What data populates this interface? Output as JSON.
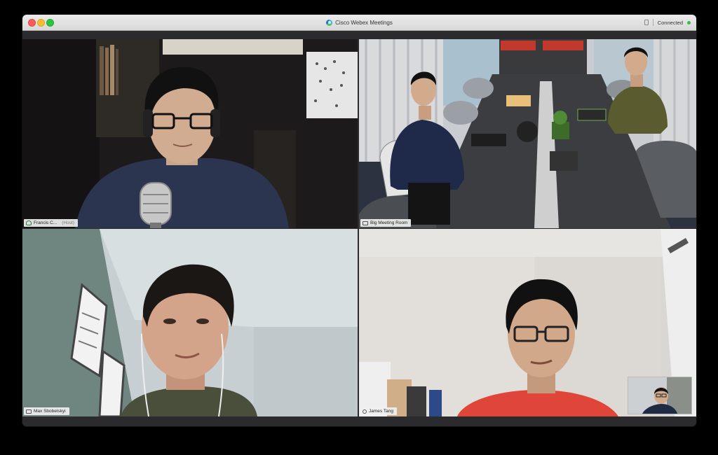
{
  "window": {
    "title": "Cisco Webex Meetings",
    "status": "Connected",
    "logo_icon": "webex-logo-icon"
  },
  "participants": [
    {
      "name": "Francis C...",
      "role": "(Host)",
      "icon": "people-icon"
    },
    {
      "name": "Big Meeting Room",
      "icon": "room-device-icon"
    },
    {
      "name": "Max Sbobelskyi",
      "icon": "device-icon"
    },
    {
      "name": "James Tang",
      "icon": "phone-icon"
    }
  ],
  "colors": {
    "titlebar": "#e2e2e2",
    "connected": "#3fb950",
    "label_bg": "#f0f0f0"
  }
}
